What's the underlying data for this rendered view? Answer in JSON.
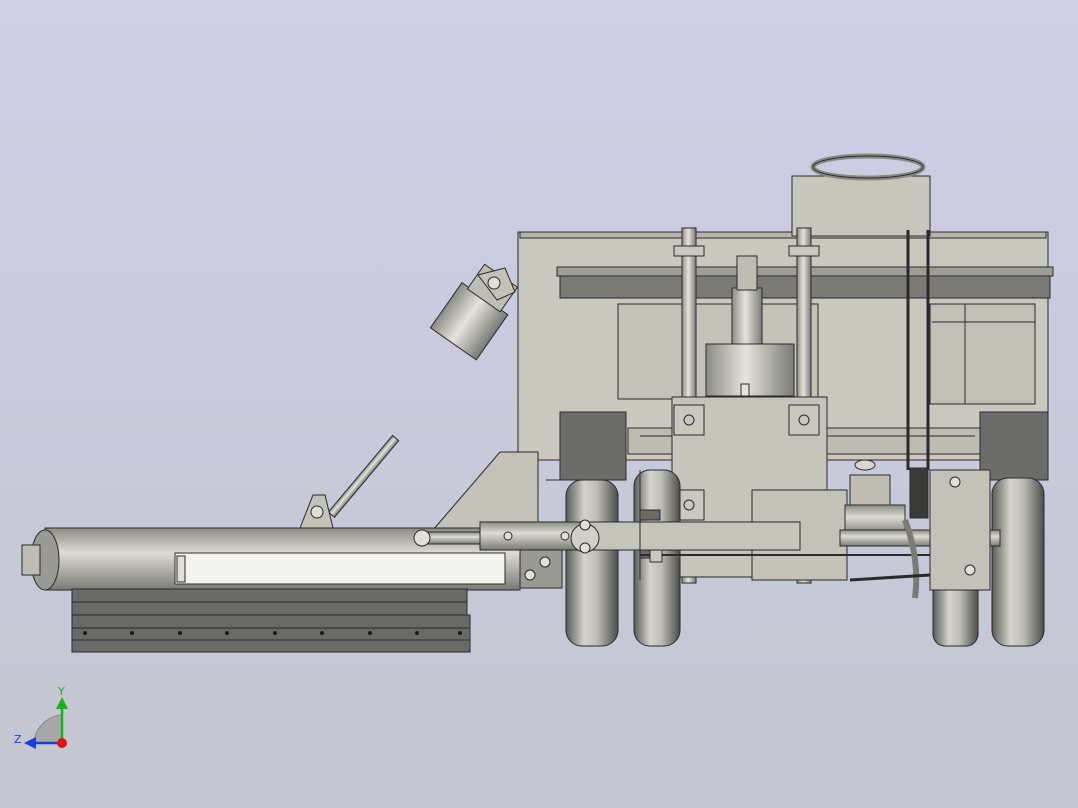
{
  "viewport": {
    "background_top": "#cfcfe6",
    "background_bottom": "#c4c6d0",
    "part_fill": "#c8c8be",
    "part_fill_dark": "#6e6e6c",
    "part_fill_light": "#f2f2ee",
    "edge_color": "#2a2a2a"
  },
  "triad": {
    "y_label": "Y",
    "z_label": "Z",
    "y_color": "#16b416",
    "z_color": "#1a3fd6",
    "x_color": "#e01010"
  }
}
